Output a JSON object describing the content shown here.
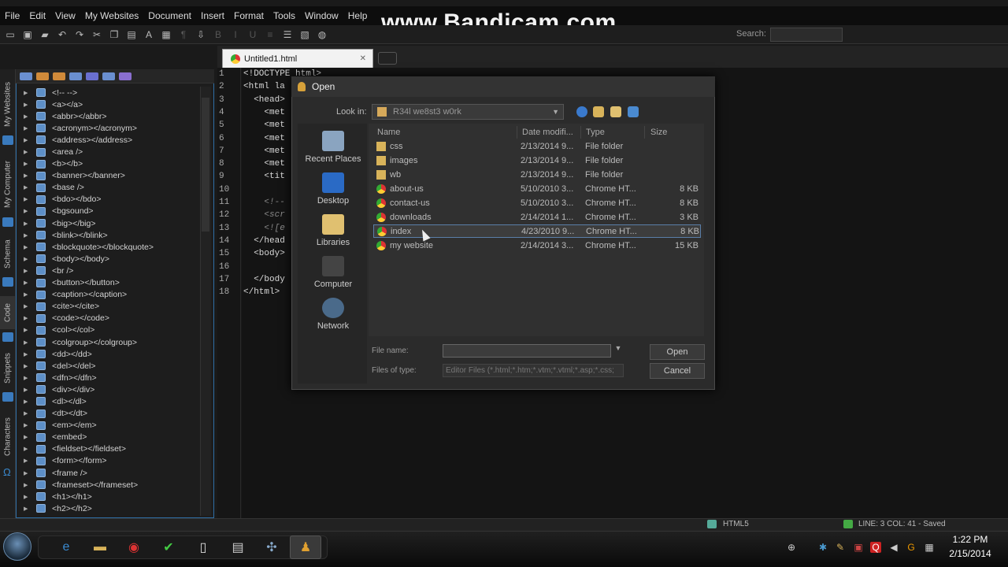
{
  "watermark": "www.Bandicam.com",
  "menu": [
    "File",
    "Edit",
    "View",
    "My Websites",
    "Document",
    "Insert",
    "Format",
    "Tools",
    "Window",
    "Help"
  ],
  "toolbar": {
    "search_label": "Search:",
    "search_value": ""
  },
  "side_tabs": [
    "My Websites",
    "My Computer",
    "Schema",
    "Code",
    "Snippets",
    "Characters"
  ],
  "tags": [
    "<!-- -->",
    "<a></a>",
    "<abbr></abbr>",
    "<acronym></acronym>",
    "<address></address>",
    "<area />",
    "<b></b>",
    "<banner></banner>",
    "<base />",
    "<bdo></bdo>",
    "<bgsound>",
    "<big></big>",
    "<blink></blink>",
    "<blockquote></blockquote>",
    "<body></body>",
    "<br />",
    "<button></button>",
    "<caption></caption>",
    "<cite></cite>",
    "<code></code>",
    "<col></col>",
    "<colgroup></colgroup>",
    "<dd></dd>",
    "<del></del>",
    "<dfn></dfn>",
    "<div></div>",
    "<dl></dl>",
    "<dt></dt>",
    "<em></em>",
    "<embed>",
    "<fieldset></fieldset>",
    "<form></form>",
    "<frame />",
    "<frameset></frameset>",
    "<h1></h1>",
    "<h2></h2>"
  ],
  "editor": {
    "tab_title": "Untitled1.html",
    "line_numbers": [
      "1",
      "2",
      "3",
      "4",
      "5",
      "6",
      "7",
      "8",
      "9",
      "10",
      "11",
      "12",
      "13",
      "14",
      "15",
      "16",
      "17",
      "18"
    ],
    "lines": [
      "<!DOCTYPE html>",
      "<html la",
      "  <head>",
      "    <met",
      "    <met",
      "    <met",
      "    <met",
      "    <met",
      "    <tit",
      "",
      "    <!--",
      "    <scr",
      "    <![e",
      "  </head",
      "  <body>",
      "",
      "  </body",
      "</html>"
    ]
  },
  "dialog": {
    "title": "Open",
    "look_in_label": "Look in:",
    "look_in_value": "R34l we8st3 w0rk",
    "places": [
      "Recent Places",
      "Desktop",
      "Libraries",
      "Computer",
      "Network"
    ],
    "columns": [
      "Name",
      "Date modifi...",
      "Type",
      "Size"
    ],
    "files": [
      {
        "name": "css",
        "date": "2/13/2014 9...",
        "type": "File folder",
        "size": "",
        "icon": "folder"
      },
      {
        "name": "images",
        "date": "2/13/2014 9...",
        "type": "File folder",
        "size": "",
        "icon": "folder"
      },
      {
        "name": "wb",
        "date": "2/13/2014 9...",
        "type": "File folder",
        "size": "",
        "icon": "folder"
      },
      {
        "name": "about-us",
        "date": "5/10/2010 3...",
        "type": "Chrome HT...",
        "size": "8 KB",
        "icon": "chrome"
      },
      {
        "name": "contact-us",
        "date": "5/10/2010 3...",
        "type": "Chrome HT...",
        "size": "8 KB",
        "icon": "chrome"
      },
      {
        "name": "downloads",
        "date": "2/14/2014 1...",
        "type": "Chrome HT...",
        "size": "3 KB",
        "icon": "chrome"
      },
      {
        "name": "index",
        "date": "4/23/2010 9...",
        "type": "Chrome HT...",
        "size": "8 KB",
        "icon": "chrome",
        "selected": true
      },
      {
        "name": "my website",
        "date": "2/14/2014 3...",
        "type": "Chrome HT...",
        "size": "15 KB",
        "icon": "chrome"
      }
    ],
    "file_name_label": "File name:",
    "file_name_value": "",
    "files_of_type_label": "Files of type:",
    "files_of_type_value": "Editor Files (*.html;*.htm;*.vtm;*.vtml;*.asp;*.css;",
    "open_button": "Open",
    "cancel_button": "Cancel"
  },
  "status": {
    "mode": "HTML5",
    "position": "LINE: 3  COL: 41 - Saved"
  },
  "taskbar": {
    "time": "1:22 PM",
    "date": "2/15/2014"
  }
}
